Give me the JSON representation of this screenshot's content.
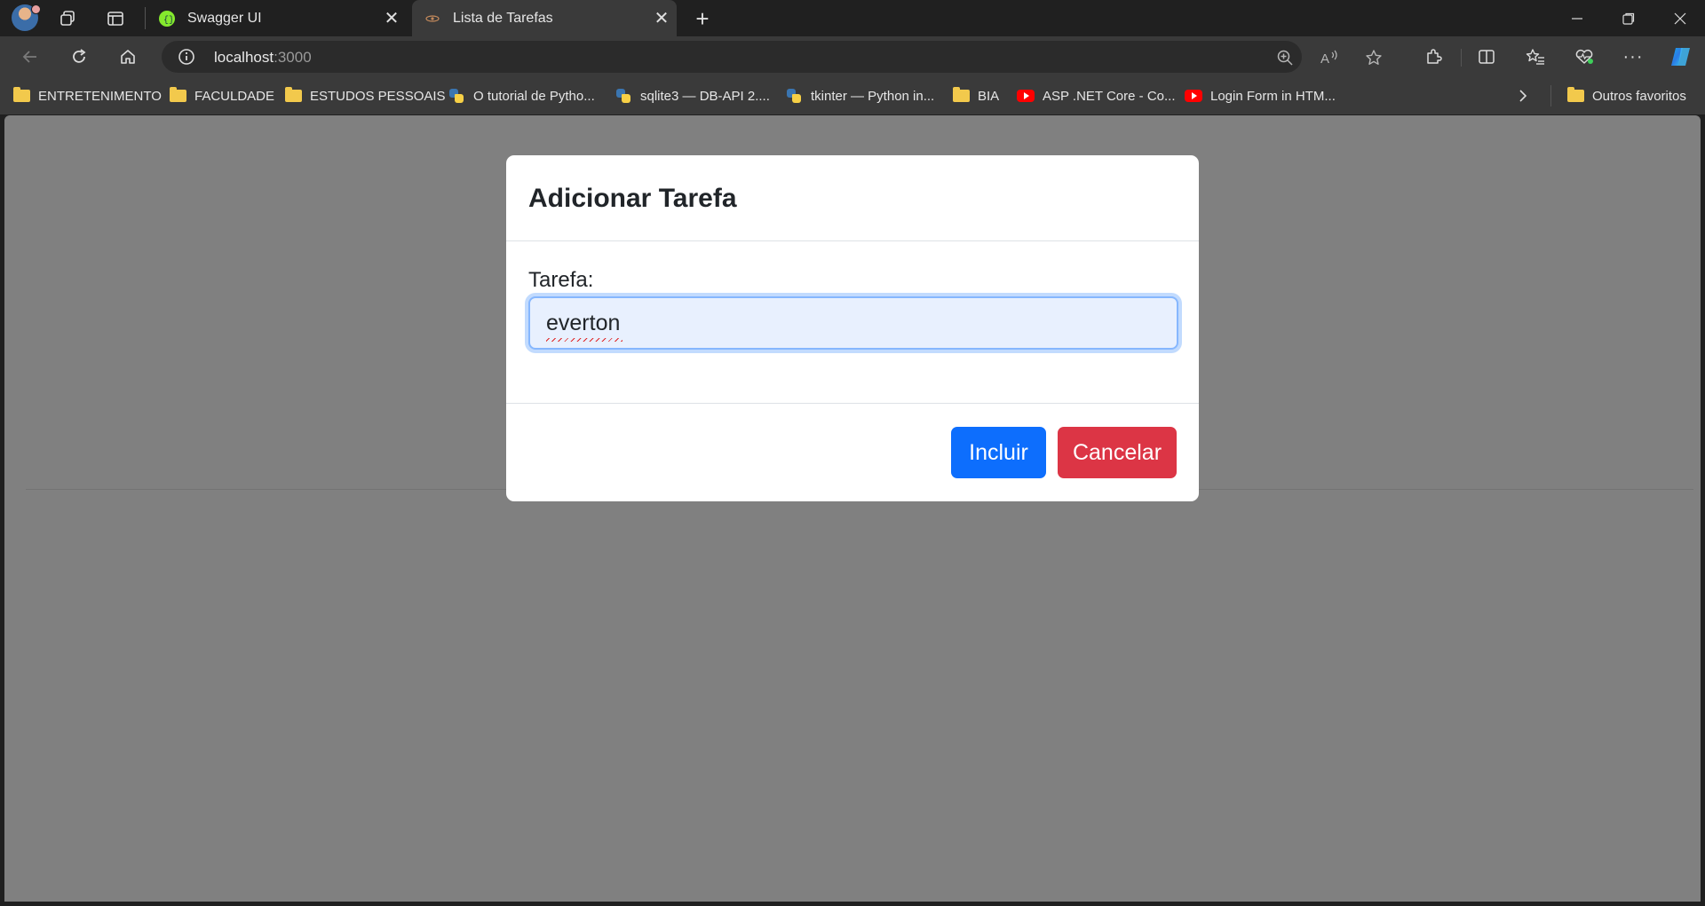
{
  "browser": {
    "tabs": [
      {
        "title": "Swagger UI",
        "favicon": "swagger-icon",
        "active": false
      },
      {
        "title": "Lista de Tarefas",
        "favicon": "react-icon",
        "active": true
      }
    ],
    "address": {
      "host": "localhost",
      "port": ":3000"
    },
    "bookmarks": [
      {
        "label": "ENTRETENIMENTO",
        "icon": "folder-icon"
      },
      {
        "label": "FACULDADE",
        "icon": "folder-icon"
      },
      {
        "label": "ESTUDOS PESSOAIS",
        "icon": "folder-icon"
      },
      {
        "label": "O tutorial de Pytho...",
        "icon": "python-icon"
      },
      {
        "label": "sqlite3 — DB-API 2....",
        "icon": "python-icon"
      },
      {
        "label": "tkinter — Python in...",
        "icon": "python-icon"
      },
      {
        "label": "BIA",
        "icon": "folder-icon"
      },
      {
        "label": "ASP .NET Core - Co...",
        "icon": "youtube-icon"
      },
      {
        "label": "Login Form in HTM...",
        "icon": "youtube-icon"
      }
    ],
    "other_favorites": "Outros favoritos"
  },
  "modal": {
    "title": "Adicionar Tarefa",
    "field_label": "Tarefa:",
    "field_value": "everton",
    "confirm_label": "Incluir",
    "cancel_label": "Cancelar"
  },
  "colors": {
    "primary": "#0d6efd",
    "danger": "#dc3545",
    "backdrop": "#808080",
    "browser_chrome": "#3a3a3a"
  }
}
